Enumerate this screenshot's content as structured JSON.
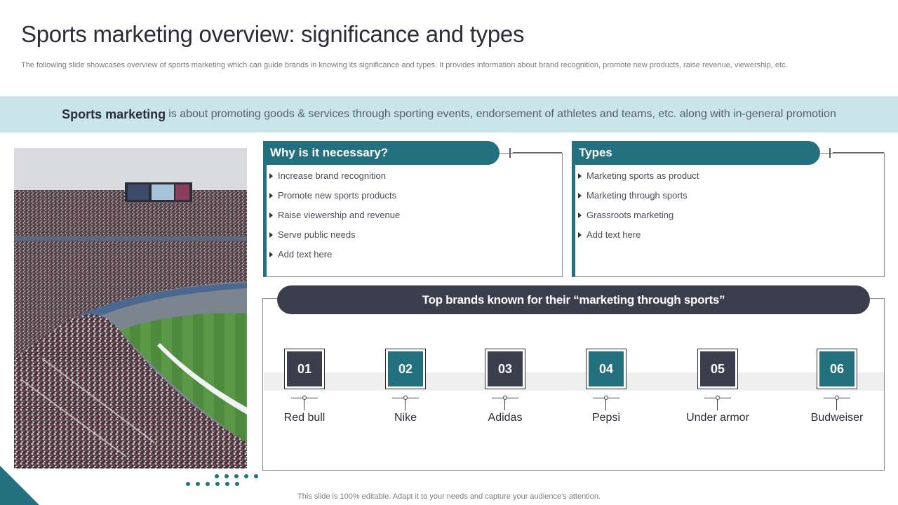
{
  "title": "Sports marketing overview: significance and types",
  "subtitle": "The following slide showcases overview of sports marketing which can guide brands in knowing its significance and types. It provides information about brand recognition, promote new products, raise revenue, viewership, etc.",
  "banner": {
    "lead": "Sports marketing",
    "text": "is about promoting goods & services through sporting events, endorsement of athletes and teams, etc. along with in-general promotion"
  },
  "necessary": {
    "heading": "Why is it necessary?",
    "items": [
      "Increase brand recognition",
      "Promote new sports products",
      "Raise viewership  and revenue",
      "Serve  public needs",
      "Add text here"
    ]
  },
  "types": {
    "heading": "Types",
    "items": [
      "Marketing sports as product",
      "Marketing through sports",
      "Grassroots marketing",
      "Add text here"
    ]
  },
  "brands": {
    "heading": "Top brands known for their “marketing through sports”",
    "items": [
      {
        "num": "01",
        "name": "Red bull"
      },
      {
        "num": "02",
        "name": "Nike"
      },
      {
        "num": "03",
        "name": "Adidas"
      },
      {
        "num": "04",
        "name": "Pepsi"
      },
      {
        "num": "05",
        "name": "Under armor"
      },
      {
        "num": "06",
        "name": "Budweiser"
      }
    ]
  },
  "footer": "This slide is 100% editable. Adapt it to your needs and capture your audience's attention.",
  "colors": {
    "teal": "#23707e",
    "navy": "#3a3e4d",
    "banner": "#c9e5ea"
  }
}
